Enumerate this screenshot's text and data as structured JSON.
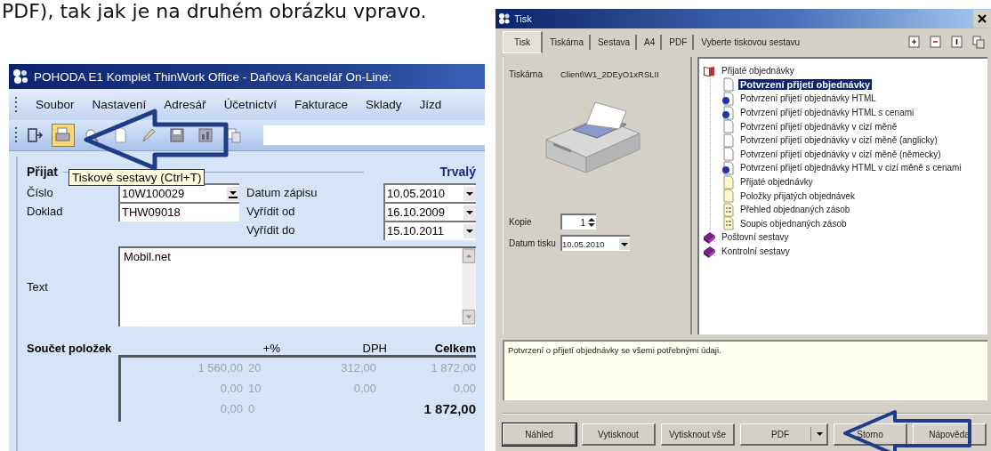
{
  "caption": "PDF), tak jak je na druhém obrázku vpravo.",
  "main_window": {
    "title": "POHODA E1 Komplet ThinWork Office - Daňová Kancelář On-Line:",
    "menu": [
      "Soubor",
      "Nastavení",
      "Adresář",
      "Účetnictví",
      "Fakturace",
      "Sklady",
      "Jízd"
    ],
    "toolbar": [
      {
        "kind": "exit",
        "hovered": false
      },
      {
        "kind": "reports",
        "hovered": true
      },
      {
        "kind": "preview",
        "hovered": false
      },
      {
        "kind": "page",
        "hovered": false
      },
      {
        "kind": "pen",
        "hovered": false
      },
      {
        "kind": "save",
        "hovered": false
      },
      {
        "kind": "chart",
        "hovered": false
      },
      {
        "kind": "copy",
        "hovered": false
      }
    ],
    "tooltip": "Tiskové sestavy (Ctrl+T)",
    "section_title": "Přijat",
    "badge": "Trvalý",
    "fields": [
      {
        "label": "Číslo",
        "value": "10W100029"
      },
      {
        "label": "Datum zápisu",
        "value": "10.05.2010"
      },
      {
        "label": "Doklad",
        "value": "THW09018"
      },
      {
        "label": "Vyřídit od",
        "value": "16.10.2009"
      },
      {
        "label": "Vyřídit do",
        "value": "15.10.2011"
      }
    ],
    "text_label": "Text",
    "text_value": "Mobil.net",
    "summary": {
      "headers": [
        "Součet položek",
        "+%",
        "DPH",
        "Celkem"
      ],
      "rows": [
        {
          "base": "1 560,00",
          "rate": "20",
          "vat": "312,00",
          "total": "1 872,00",
          "grand": false
        },
        {
          "base": "0,00",
          "rate": "10",
          "vat": "0,00",
          "total": "0,00",
          "grand": false
        },
        {
          "base": "0,00",
          "rate": "0",
          "total": "1 872,00",
          "grand": true
        }
      ]
    }
  },
  "print_dialog": {
    "title": "Tisk",
    "tabs": [
      {
        "label": "Tisk",
        "selected": true
      },
      {
        "label": "Tiskárna",
        "selected": false
      },
      {
        "label": "Sestava",
        "selected": false
      },
      {
        "label": "A4",
        "selected": false
      },
      {
        "label": "PDF",
        "selected": false
      }
    ],
    "hint": "Vyberte tiskovou sestavu",
    "printer_label": "Tiskárna",
    "printer": "Client\\W1_2DEyO1xRSLII",
    "copies_label": "Kopie",
    "copies": "1",
    "date_label": "Datum tisku",
    "date": "10.05.2010",
    "tree": [
      {
        "label": "Přijaté objednávky",
        "kind": "book-open",
        "selected": false,
        "children": [
          {
            "label": "Potvrzení přijetí objednávky",
            "kind": "doc",
            "selected": true
          },
          {
            "label": "Potvrzení přijetí objednávky HTML",
            "kind": "html",
            "selected": false
          },
          {
            "label": "Potvrzení přijetí objednávky HTML s cenami",
            "kind": "html",
            "selected": false
          },
          {
            "label": "Potvrzení přijetí objednávky v cizí měně",
            "kind": "doc",
            "selected": false
          },
          {
            "label": "Potvrzení přijetí objednávky v cizí měně (anglicky)",
            "kind": "doc",
            "selected": false
          },
          {
            "label": "Potvrzení přijetí objednávky v cizí měně (německy)",
            "kind": "doc",
            "selected": false
          },
          {
            "label": "Potvrzení přijetí objednávky HTML v cizí měně s cenami",
            "kind": "html",
            "selected": false
          },
          {
            "label": "Přijaté objednávky",
            "kind": "note",
            "selected": false
          },
          {
            "label": "Položky přijatých objednávek",
            "kind": "note",
            "selected": false
          },
          {
            "label": "Přehled objednaných zásob",
            "kind": "list",
            "selected": false
          },
          {
            "label": "Soupis objednaných zásob",
            "kind": "list",
            "selected": false
          }
        ]
      },
      {
        "label": "Poštovní sestavy",
        "kind": "book",
        "selected": false
      },
      {
        "label": "Kontrolní sestavy",
        "kind": "book",
        "selected": false
      }
    ],
    "description": "Potvrzení o přijetí objednávky se všemi potřebnými údaji.",
    "buttons": [
      {
        "label": "Náhled",
        "kind": "default"
      },
      {
        "label": "Vytisknout",
        "kind": "plain"
      },
      {
        "label": "Vytisknout vše",
        "kind": "plain"
      },
      {
        "label": "PDF",
        "kind": "split"
      },
      {
        "label": "Storno",
        "kind": "plain"
      },
      {
        "label": "Nápověda",
        "kind": "plain"
      }
    ]
  }
}
